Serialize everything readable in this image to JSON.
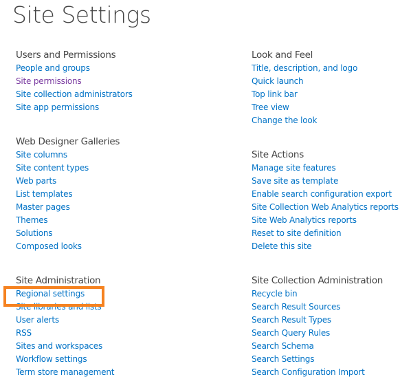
{
  "page": {
    "title": "Site Settings"
  },
  "accent": {
    "link": "#0072c6",
    "visited": "#7a3aa0",
    "highlight": "#f58220"
  },
  "sections": {
    "users_permissions": {
      "title": "Users and Permissions",
      "links": [
        "People and groups",
        "Site permissions",
        "Site collection administrators",
        "Site app permissions"
      ]
    },
    "look_feel": {
      "title": "Look and Feel",
      "links": [
        "Title, description, and logo",
        "Quick launch",
        "Top link bar",
        "Tree view",
        "Change the look"
      ]
    },
    "web_designer": {
      "title": "Web Designer Galleries",
      "links": [
        "Site columns",
        "Site content types",
        "Web parts",
        "List templates",
        "Master pages",
        "Themes",
        "Solutions",
        "Composed looks"
      ]
    },
    "site_actions": {
      "title": "Site Actions",
      "links": [
        "Manage site features",
        "Save site as template",
        "Enable search configuration export",
        "Site Collection Web Analytics reports",
        "Site Web Analytics reports",
        "Reset to site definition",
        "Delete this site"
      ]
    },
    "site_admin": {
      "title": "Site Administration",
      "links": [
        "Regional settings",
        "Site libraries and lists",
        "User alerts",
        "RSS",
        "Sites and workspaces",
        "Workflow settings",
        "Term store management"
      ]
    },
    "site_collection_admin": {
      "title": "Site Collection Administration",
      "links": [
        "Recycle bin",
        "Search Result Sources",
        "Search Result Types",
        "Search Query Rules",
        "Search Schema",
        "Search Settings",
        "Search Configuration Import"
      ]
    }
  },
  "highlighted_link": "Regional settings"
}
